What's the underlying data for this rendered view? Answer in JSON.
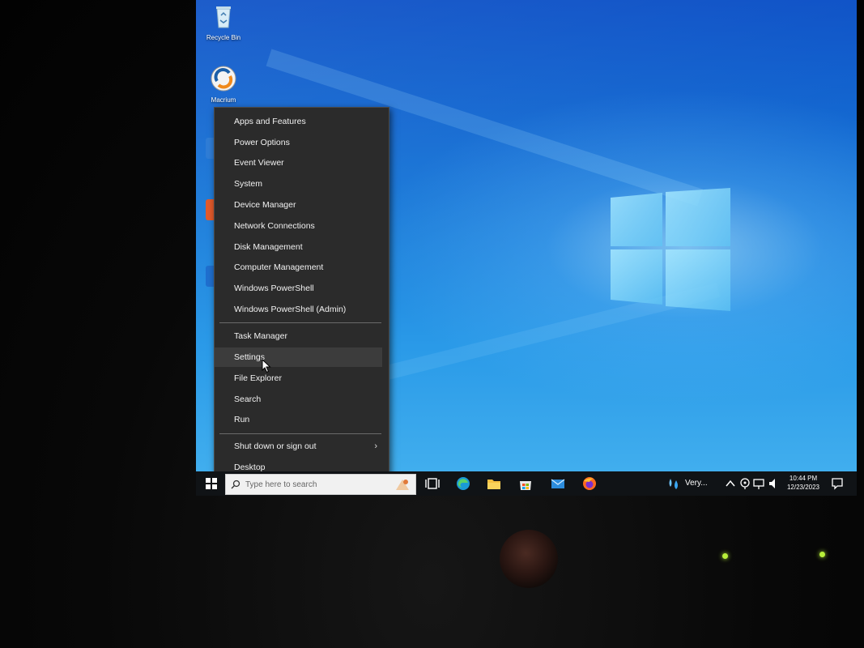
{
  "desktop": {
    "icons": [
      {
        "label": "Recycle Bin",
        "icon": "recycle-bin-icon"
      },
      {
        "label": "Macrium",
        "icon": "macrium-reflect-icon"
      }
    ]
  },
  "context_menu": {
    "group1": [
      {
        "label": "Apps and Features"
      },
      {
        "label": "Power Options"
      },
      {
        "label": "Event Viewer"
      },
      {
        "label": "System"
      },
      {
        "label": "Device Manager"
      },
      {
        "label": "Network Connections"
      },
      {
        "label": "Disk Management"
      },
      {
        "label": "Computer Management"
      },
      {
        "label": "Windows PowerShell"
      },
      {
        "label": "Windows PowerShell (Admin)"
      }
    ],
    "group2": [
      {
        "label": "Task Manager"
      },
      {
        "label": "Settings",
        "hovered": true
      },
      {
        "label": "File Explorer"
      },
      {
        "label": "Search"
      },
      {
        "label": "Run"
      }
    ],
    "group3": [
      {
        "label": "Shut down or sign out",
        "has_submenu": true
      },
      {
        "label": "Desktop"
      }
    ]
  },
  "taskbar": {
    "search_placeholder": "Type here to search",
    "pinned": [
      "task-view-icon",
      "edge-icon",
      "file-explorer-icon",
      "microsoft-store-icon",
      "mail-icon",
      "firefox-icon"
    ],
    "weather": {
      "text": "Very...",
      "icon": "weather-rain-icon"
    },
    "tray_icons": [
      "chevron-up-icon",
      "webcam-icon",
      "network-icon",
      "volume-icon"
    ],
    "clock": {
      "time": "10:44 PM",
      "date": "12/23/2023"
    },
    "notification_icon": "action-center-icon"
  },
  "colors": {
    "menu_bg": "#2b2b2b",
    "menu_hover": "#3c3c3c",
    "taskbar_bg": "#101316",
    "wallpaper": "#1978d8",
    "monitor_led": "#b8f03a"
  }
}
